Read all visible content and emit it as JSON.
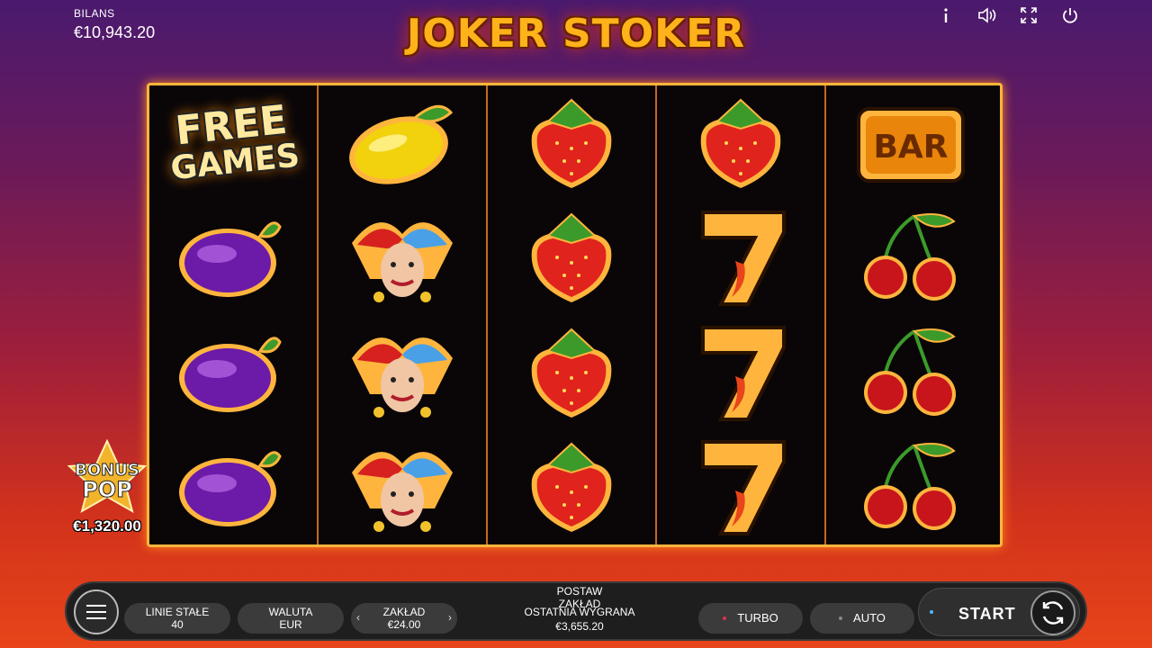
{
  "header": {
    "balance_label": "BILANS",
    "balance_value": "€10,943.20",
    "game_title": "JOKER STOKER",
    "icons": [
      "info-icon",
      "sound-icon",
      "fullscreen-icon",
      "power-icon"
    ]
  },
  "reels": [
    [
      "free-games",
      "plum",
      "plum",
      "plum"
    ],
    [
      "lemon",
      "joker",
      "joker",
      "joker"
    ],
    [
      "strawberry",
      "strawberry",
      "strawberry",
      "strawberry"
    ],
    [
      "strawberry",
      "seven",
      "seven",
      "seven"
    ],
    [
      "bar",
      "cherry",
      "cherry",
      "cherry"
    ]
  ],
  "symbols": {
    "free_games_line1": "FREE",
    "free_games_line2": "GAMES",
    "bar_label": "BAR"
  },
  "bonus_pop": {
    "line1": "BONUS",
    "line2": "POP",
    "amount": "€1,320.00"
  },
  "controls": {
    "bet_header": "POSTAW ZAKŁAD",
    "fixed_lines_label": "LINIE STAŁE",
    "fixed_lines_value": "40",
    "currency_label": "WALUTA",
    "currency_value": "EUR",
    "stake_label": "ZAKŁAD",
    "stake_value": "€24.00",
    "last_win_label": "OSTATNIA WYGRANA",
    "last_win_value": "€3,655.20",
    "turbo_label": "TURBO",
    "auto_label": "AUTO",
    "start_label": "START"
  },
  "colors": {
    "frame": "#ffb53d",
    "turbo_dot": "#e0304a",
    "start_dot": "#4fb8ff"
  }
}
